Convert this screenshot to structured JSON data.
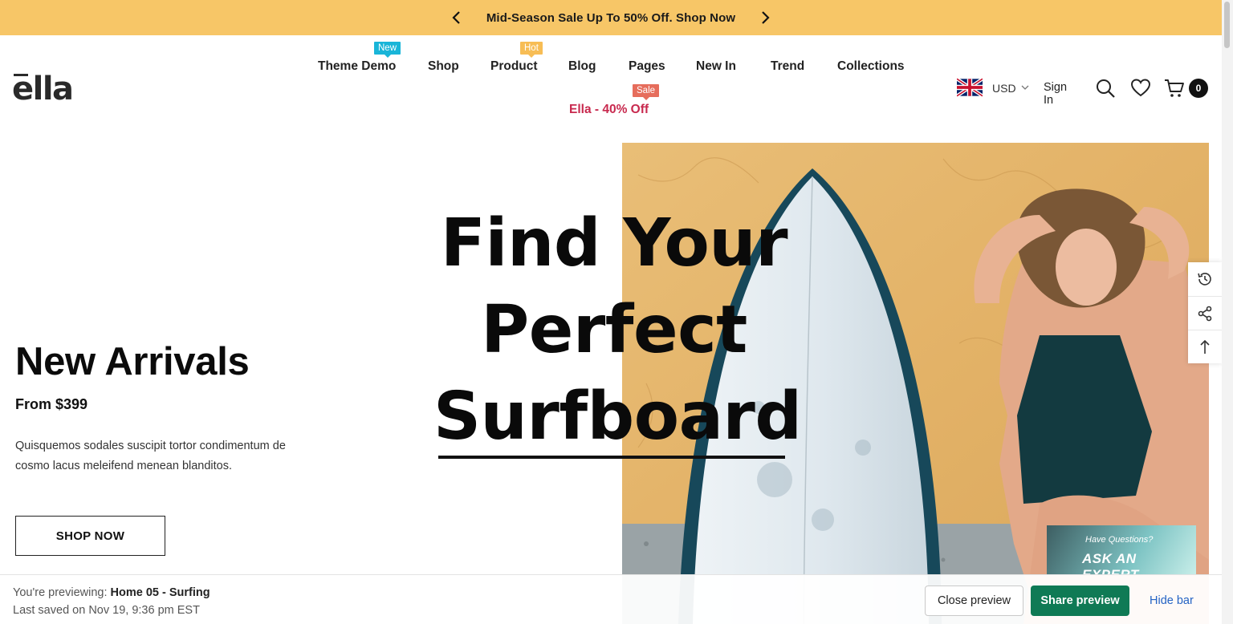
{
  "announcement": {
    "text": "Mid-Season Sale Up To 50% Off. Shop Now"
  },
  "header": {
    "logo": "ella",
    "nav": [
      {
        "label": "Theme Demo",
        "badge": "New"
      },
      {
        "label": "Shop",
        "badge": ""
      },
      {
        "label": "Product",
        "badge": "Hot"
      },
      {
        "label": "Blog",
        "badge": ""
      },
      {
        "label": "Pages",
        "badge": ""
      },
      {
        "label": "New In",
        "badge": ""
      },
      {
        "label": "Trend",
        "badge": ""
      },
      {
        "label": "Collections",
        "badge": ""
      }
    ],
    "sale_badge": "Sale",
    "sale_link": "Ella - 40% Off",
    "currency": "USD",
    "sign_in": "Sign In",
    "cart_count": "0"
  },
  "hero": {
    "headline_line1": "Find Your",
    "headline_line2": "Perfect",
    "headline_line3": "Surfboard",
    "title": "New Arrivals",
    "price": "From $399",
    "description": "Quisquemos sodales suscipit tortor condimentum de cosmo lacus meleifend menean blanditos.",
    "cta": "SHOP NOW",
    "expert_question": "Have Questions?",
    "expert_title": "ASK AN EXPERT"
  },
  "preview_bar": {
    "prefix": "You're previewing:",
    "theme": "Home 05 - Surfing",
    "saved": "Last saved on Nov 19, 9:36 pm EST",
    "close_label": "Close preview",
    "share_label": "Share preview",
    "hide_label": "Hide bar"
  },
  "colors": {
    "announcement_bg": "#f7c667",
    "sale_text": "#c8294e",
    "badge_new": "#19b5d8",
    "badge_hot": "#f7bd55",
    "badge_sale": "#e66d5c",
    "share_button": "#0f7a55",
    "hide_link": "#2463c4"
  }
}
